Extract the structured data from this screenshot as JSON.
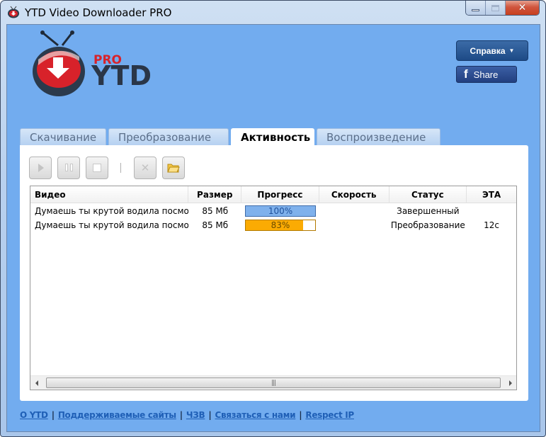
{
  "window": {
    "title": "YTD Video Downloader PRO",
    "controls": [
      "minimize",
      "maximize",
      "close"
    ]
  },
  "logo": {
    "pro_label": "PRO",
    "brand": "YTD"
  },
  "header_buttons": {
    "help_label": "Справка",
    "share_label": "Share"
  },
  "tabs": [
    {
      "label": "Скачивание",
      "active": false
    },
    {
      "label": "Преобразование",
      "active": false
    },
    {
      "label": "Активность",
      "active": true
    },
    {
      "label": "Воспроизведение",
      "active": false
    }
  ],
  "toolbar": {
    "buttons": [
      {
        "name": "play",
        "icon": "play-icon",
        "enabled": false
      },
      {
        "name": "pause",
        "icon": "pause-icon",
        "enabled": false
      },
      {
        "name": "stop",
        "icon": "stop-icon",
        "enabled": false
      },
      {
        "name": "remove",
        "icon": "x-icon",
        "enabled": false
      },
      {
        "name": "open-folder",
        "icon": "folder-icon",
        "enabled": true
      }
    ]
  },
  "table": {
    "columns": {
      "video": "Видео",
      "size": "Размер",
      "progress": "Прогресс",
      "speed": "Скорость",
      "status": "Статус",
      "eta": "ЭТА"
    },
    "rows": [
      {
        "video": "Думаешь ты крутой водила посмо...",
        "size": "85 Мб",
        "progress_text": "100%",
        "progress_value": 100,
        "speed": "",
        "status": "Завершенный",
        "eta": ""
      },
      {
        "video": "Думаешь ты крутой водила посмо...",
        "size": "85 Мб",
        "progress_text": "83%",
        "progress_value": 83,
        "speed": "",
        "status": "Преобразование",
        "eta": "12с"
      }
    ]
  },
  "footer": {
    "links": [
      "О YTD",
      "Поддерживаемые сайты",
      "ЧЗВ",
      "Связаться с нами",
      "Respect IP"
    ],
    "separator": "|"
  },
  "colors": {
    "client_bg": "#72acef",
    "progress_done": "#7fb1ec",
    "progress_converting": "#fbab03",
    "logo_red": "#d8222a",
    "link": "#1f5fb6"
  }
}
